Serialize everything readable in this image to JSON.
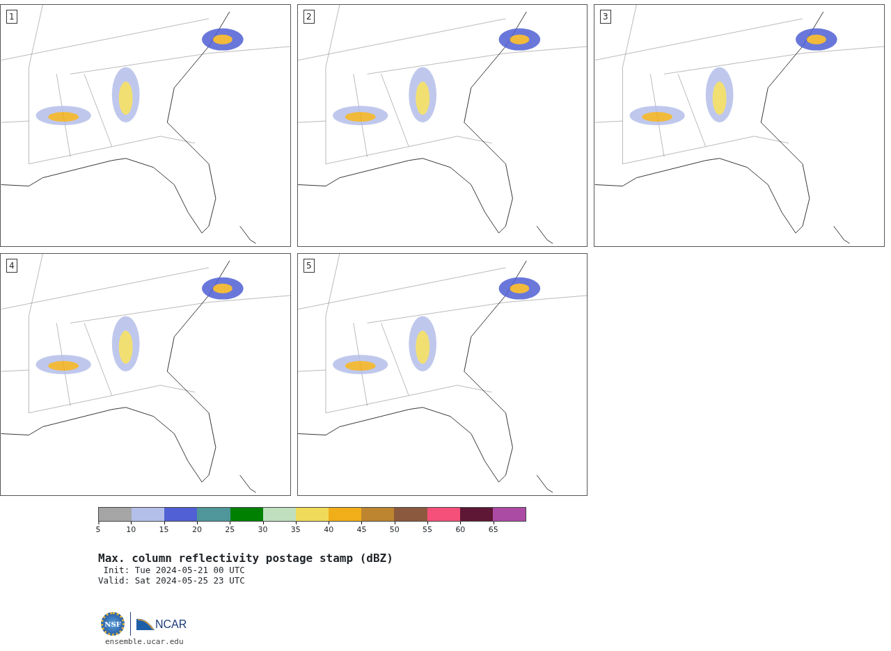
{
  "panels": [
    {
      "label": "1"
    },
    {
      "label": "2"
    },
    {
      "label": "3"
    },
    {
      "label": "4"
    },
    {
      "label": "5"
    }
  ],
  "colorbar": {
    "segments": [
      {
        "color": "#a5a5a5"
      },
      {
        "color": "#b4bfe9"
      },
      {
        "color": "#5160d4"
      },
      {
        "color": "#4e9699"
      },
      {
        "color": "#008000"
      },
      {
        "color": "#bfdfbf"
      },
      {
        "color": "#f0da5a"
      },
      {
        "color": "#f0ae19"
      },
      {
        "color": "#bd8530"
      },
      {
        "color": "#8b5a3e"
      },
      {
        "color": "#f45079"
      },
      {
        "color": "#5e1734"
      },
      {
        "color": "#ac4ba4"
      }
    ],
    "ticks": [
      "5",
      "10",
      "15",
      "20",
      "25",
      "30",
      "35",
      "40",
      "45",
      "50",
      "55",
      "60",
      "65"
    ]
  },
  "title": "Max. column reflectivity postage stamp (dBZ)",
  "init": " Init: Tue 2024-05-21 00 UTC",
  "valid": "Valid: Sat 2024-05-25 23 UTC",
  "logo": {
    "nsf": "NSF",
    "ncar": "NCAR"
  },
  "url": "ensemble.ucar.edu"
}
